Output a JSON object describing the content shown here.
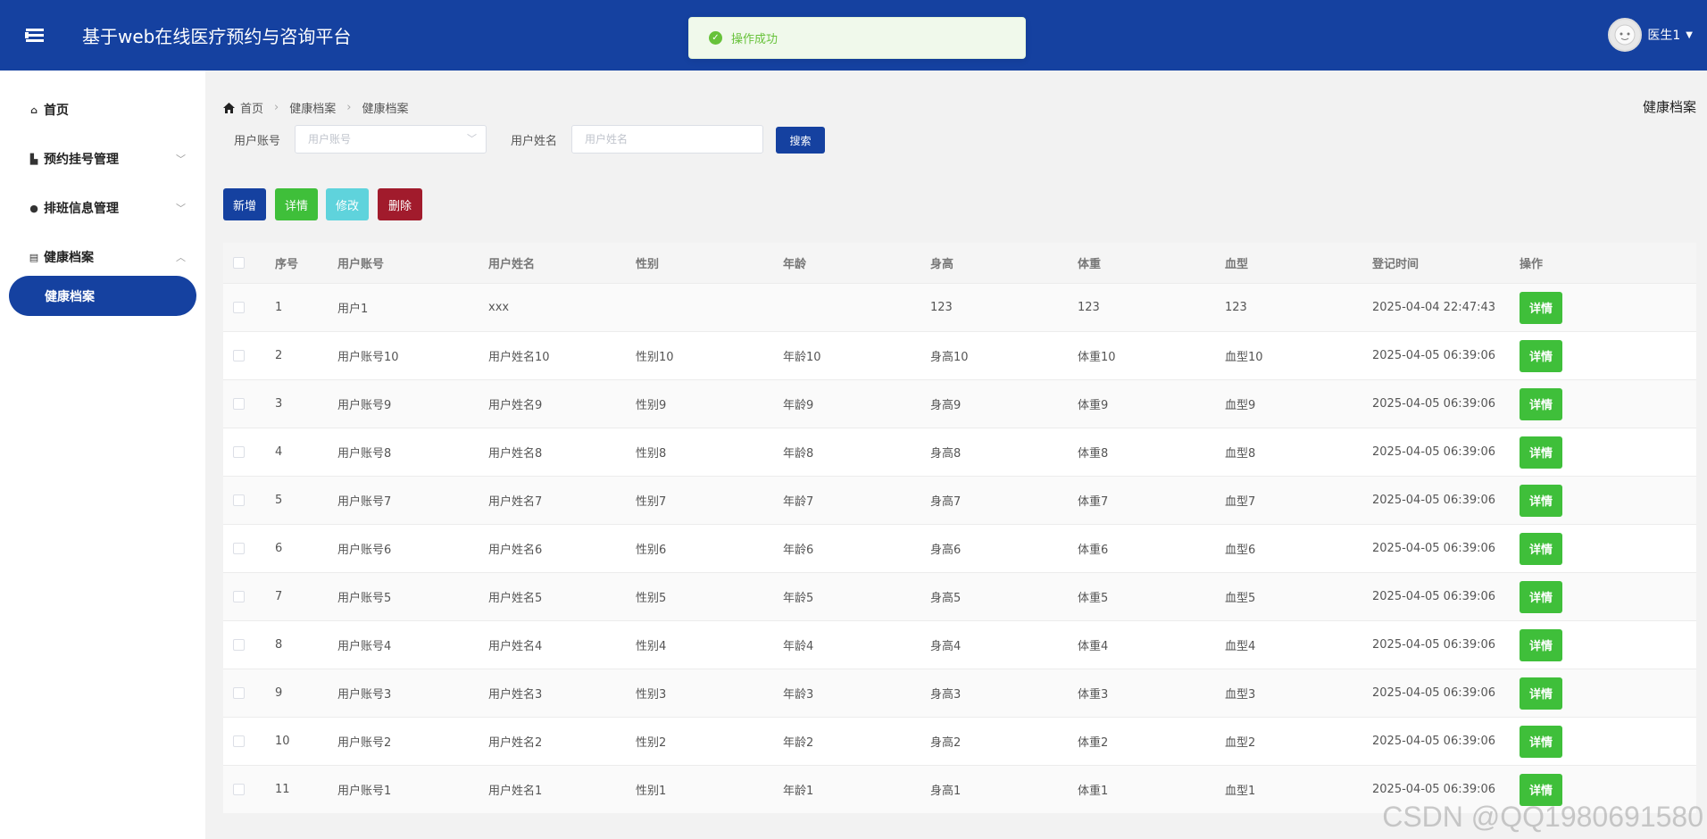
{
  "header": {
    "title": "基于web在线医疗预约与咨询平台",
    "toast": "操作成功",
    "user_name": "医生1"
  },
  "sidebar": {
    "items": [
      {
        "label": "首页",
        "icon": "home-icon"
      },
      {
        "label": "预约挂号管理",
        "icon": "building-icon"
      },
      {
        "label": "排班信息管理",
        "icon": "clock-icon"
      },
      {
        "label": "健康档案",
        "icon": "folder-icon"
      }
    ],
    "active_sub": "健康档案"
  },
  "breadcrumb": [
    "首页",
    "健康档案",
    "健康档案"
  ],
  "page_heading": "健康档案",
  "filters": {
    "account_label": "用户账号",
    "account_placeholder": "用户账号",
    "name_label": "用户姓名",
    "name_placeholder": "用户姓名",
    "search_label": "搜索"
  },
  "actions": {
    "add": "新增",
    "detail": "详情",
    "edit": "修改",
    "delete": "删除",
    "colors": {
      "add": "#1541a0",
      "detail": "#3fbf3a",
      "edit": "#5fd3dc",
      "delete": "#a11b2c"
    }
  },
  "table": {
    "columns": [
      "序号",
      "用户账号",
      "用户姓名",
      "性别",
      "年龄",
      "身高",
      "体重",
      "血型",
      "登记时间",
      "操作"
    ],
    "rows": [
      [
        "1",
        "用户1",
        "xxx",
        "",
        "",
        "123",
        "123",
        "123",
        "2025-04-04 22:47:43"
      ],
      [
        "2",
        "用户账号10",
        "用户姓名10",
        "性别10",
        "年龄10",
        "身高10",
        "体重10",
        "血型10",
        "2025-04-05 06:39:06"
      ],
      [
        "3",
        "用户账号9",
        "用户姓名9",
        "性别9",
        "年龄9",
        "身高9",
        "体重9",
        "血型9",
        "2025-04-05 06:39:06"
      ],
      [
        "4",
        "用户账号8",
        "用户姓名8",
        "性别8",
        "年龄8",
        "身高8",
        "体重8",
        "血型8",
        "2025-04-05 06:39:06"
      ],
      [
        "5",
        "用户账号7",
        "用户姓名7",
        "性别7",
        "年龄7",
        "身高7",
        "体重7",
        "血型7",
        "2025-04-05 06:39:06"
      ],
      [
        "6",
        "用户账号6",
        "用户姓名6",
        "性别6",
        "年龄6",
        "身高6",
        "体重6",
        "血型6",
        "2025-04-05 06:39:06"
      ],
      [
        "7",
        "用户账号5",
        "用户姓名5",
        "性别5",
        "年龄5",
        "身高5",
        "体重5",
        "血型5",
        "2025-04-05 06:39:06"
      ],
      [
        "8",
        "用户账号4",
        "用户姓名4",
        "性别4",
        "年龄4",
        "身高4",
        "体重4",
        "血型4",
        "2025-04-05 06:39:06"
      ],
      [
        "9",
        "用户账号3",
        "用户姓名3",
        "性别3",
        "年龄3",
        "身高3",
        "体重3",
        "血型3",
        "2025-04-05 06:39:06"
      ],
      [
        "10",
        "用户账号2",
        "用户姓名2",
        "性别2",
        "年龄2",
        "身高2",
        "体重2",
        "血型2",
        "2025-04-05 06:39:06"
      ],
      [
        "11",
        "用户账号1",
        "用户姓名1",
        "性别1",
        "年龄1",
        "身高1",
        "体重1",
        "血型1",
        "2025-04-05 06:39:06"
      ]
    ],
    "row_action": "详情"
  },
  "watermark": "CSDN @QQ1980691580"
}
